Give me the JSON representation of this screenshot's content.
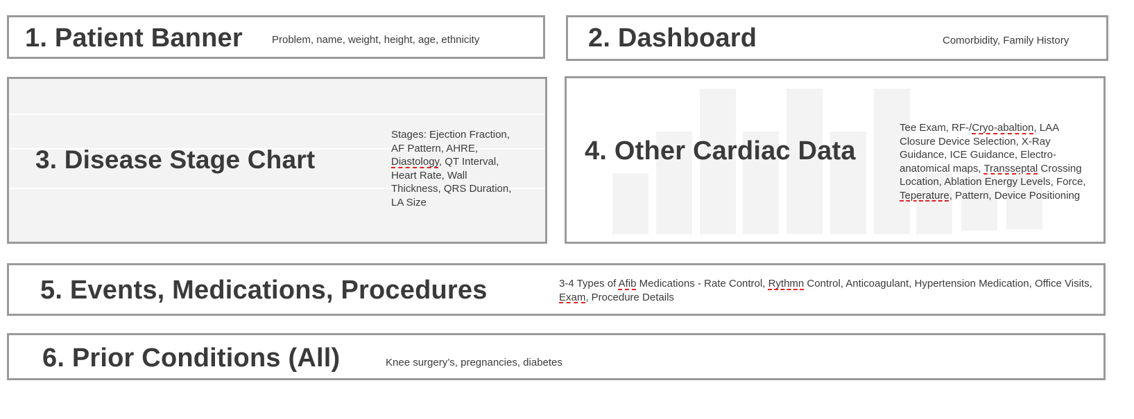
{
  "sections": [
    {
      "title": "1. Patient Banner",
      "description": "Problem, name, weight, height, age, ethnicity"
    },
    {
      "title": "2. Dashboard",
      "description": "Comorbidity, Family History"
    },
    {
      "title": "3. Disease Stage Chart",
      "description_parts": [
        "Stages: Ejection Fraction, AF Pattern, AHRE, ",
        "Diastology",
        ", QT Interval, Heart Rate, Wall Thickness, QRS Duration, LA Size"
      ]
    },
    {
      "title": "4. Other Cardiac Data",
      "description_parts": [
        "Tee Exam, RF-/",
        "Cryo-abaltion",
        ", LAA Closure Device Selection, X-Ray Guidance, ICE Guidance, Electro-anatomical maps, ",
        "Transseptal",
        " Crossing Location, Ablation Energy Levels, Force, ",
        "Teperature",
        ", Pattern, Device Positioning"
      ]
    },
    {
      "title": "5. Events, Medications, Procedures",
      "description_parts": [
        "3-4 Types of ",
        "Afib",
        " Medications - Rate Control, ",
        "Rythmn",
        " Control, Anticoagulant, Hypertension Medication, Office Visits, ",
        "Exam",
        ", Procedure Details"
      ]
    },
    {
      "title": "6. Prior Conditions (All)",
      "description": "Knee surgery’s, pregnancies, diabetes"
    }
  ]
}
